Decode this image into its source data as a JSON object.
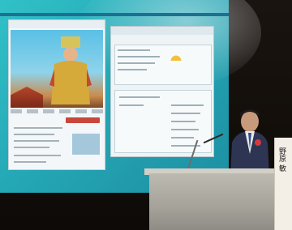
{
  "photo": {
    "description_kind": "speaker at podium in front of projected website slides"
  },
  "slide": {
    "title": "",
    "banner_line1": "",
    "banner_line2": ""
  },
  "placard": {
    "name_text": "野原 敏"
  }
}
